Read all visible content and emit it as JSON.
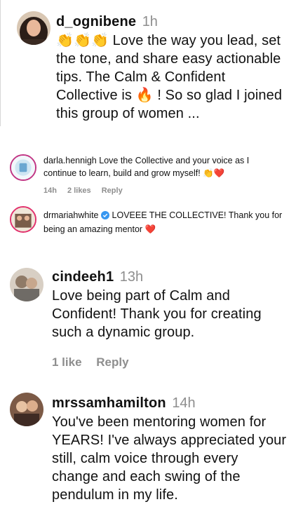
{
  "comments": [
    {
      "username": "d_ognibene",
      "time": "1h",
      "text_lines": [
        "👏👏👏 Love the way you lead, set",
        "the tone, and share easy actionable",
        "tips. The Calm & Confident",
        "Collective is 🔥 ! So so glad I joined",
        "this group of women ..."
      ]
    },
    {
      "username": "darla.hennigh",
      "text_line1": "Love the Collective and your voice as I",
      "text_line2": "continue to learn, build and grow myself! 👏❤️",
      "time": "14h",
      "likes": "2 likes",
      "reply": "Reply"
    },
    {
      "username": "drmariahwhite",
      "verified": true,
      "text_line1": "LOVEEE THE COLLECTIVE! Thank you for",
      "text_line2": "being an amazing mentor ❤️"
    },
    {
      "username": "cindeeh1",
      "time": "13h",
      "text_lines": [
        "Love being part of Calm and",
        "Confident! Thank you for creating",
        "such a dynamic group."
      ],
      "likes": "1 like",
      "reply": "Reply"
    },
    {
      "username": "mrssamhamilton",
      "time": "14h",
      "text_lines": [
        "You've been mentoring women for",
        "YEARS! I've always appreciated your",
        "still, calm voice through every",
        "change and each swing of the",
        "pendulum in my life."
      ]
    }
  ],
  "colors": {
    "muted": "#8e8e8e",
    "verified_blue": "#3897f0",
    "text": "#111111"
  }
}
